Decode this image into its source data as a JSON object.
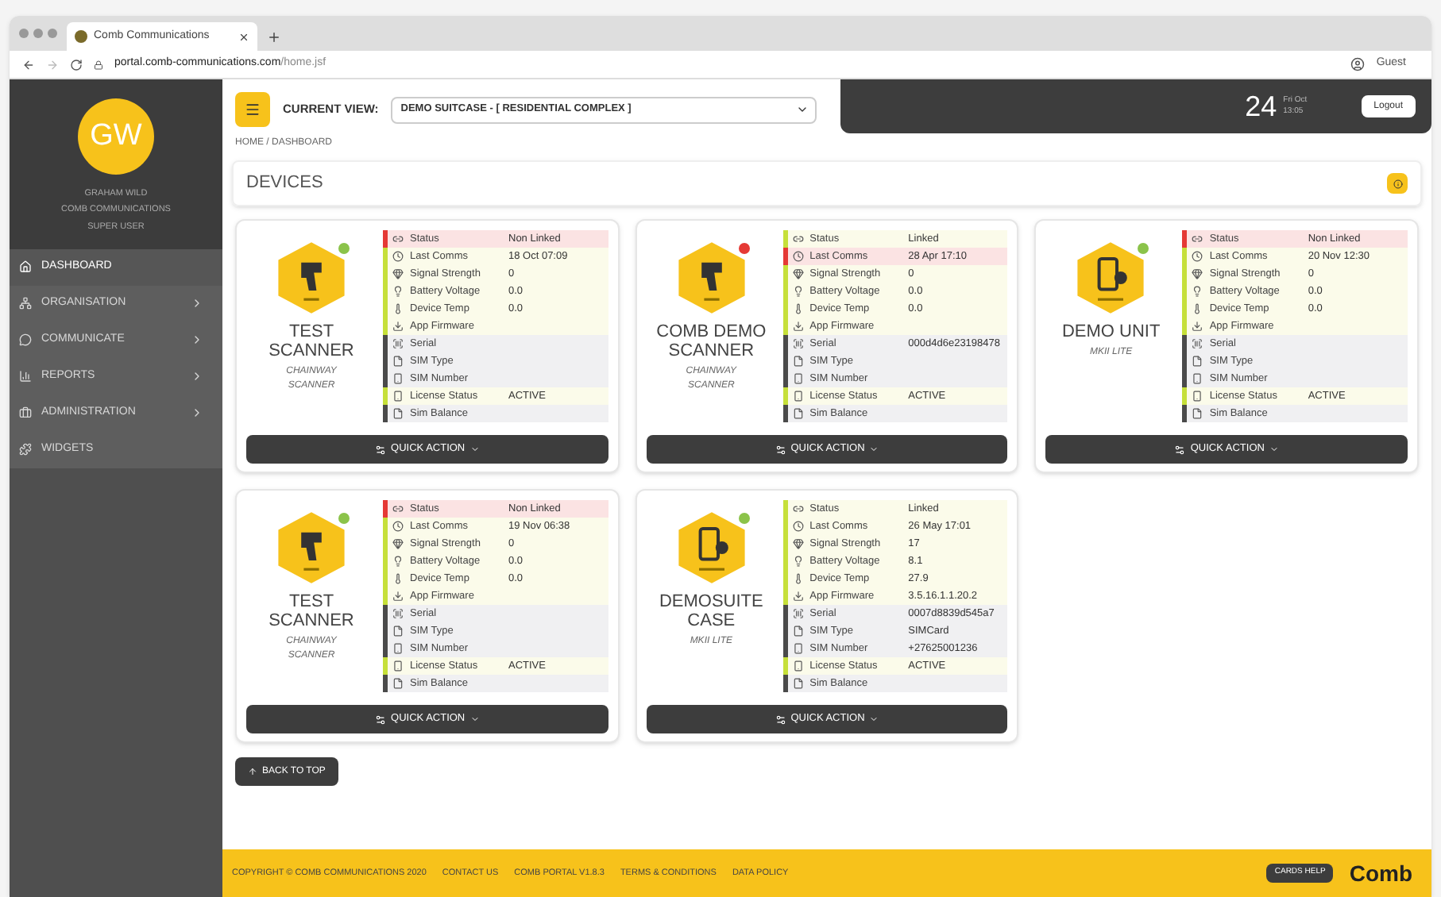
{
  "browser": {
    "tab_title": "Comb Communications",
    "url_host": "portal.comb-communications.com",
    "url_path": "/home.jsf",
    "profile": "Guest"
  },
  "sidebar": {
    "avatar": "GW",
    "user_name": "GRAHAM WILD",
    "company": "COMB COMMUNICATIONS",
    "role": "SUPER USER",
    "items": [
      {
        "label": "DASHBOARD",
        "kind": "home",
        "selected": true,
        "expandable": false
      },
      {
        "label": "ORGANISATION",
        "kind": "org",
        "selected": false,
        "expandable": true
      },
      {
        "label": "COMMUNICATE",
        "kind": "chat",
        "selected": false,
        "expandable": true
      },
      {
        "label": "REPORTS",
        "kind": "chart",
        "selected": false,
        "expandable": true
      },
      {
        "label": "ADMINISTRATION",
        "kind": "admin",
        "selected": false,
        "expandable": true
      },
      {
        "label": "WIDGETS",
        "kind": "widget",
        "selected": false,
        "expandable": false
      }
    ]
  },
  "header": {
    "current_view_label": "CURRENT VIEW:",
    "current_view": "DEMO SUITCASE - [ RESIDENTIAL COMPLEX ]",
    "day": "24",
    "month": "Fri Oct",
    "time": "13:05",
    "logout": "Logout"
  },
  "breadcrumb": "HOME / DASHBOARD",
  "devices_title": "DEVICES",
  "devices": [
    {
      "name": "TEST SCANNER",
      "model": "CHAINWAY SCANNER",
      "kind": "scanner",
      "color": "#8bc34a",
      "action": "QUICK ACTION",
      "rows": [
        {
          "label": "Status",
          "value": "Non Linked",
          "color": "#e53935"
        },
        {
          "label": "Last Comms",
          "value": "18 Oct 07:09",
          "color": "#c6e03a"
        },
        {
          "label": "Signal Strength",
          "value": "0",
          "color": "#c6e03a"
        },
        {
          "label": "Battery Voltage",
          "value": "0.0",
          "color": "#c6e03a"
        },
        {
          "label": "Device Temp",
          "value": "0.0",
          "color": "#c6e03a"
        },
        {
          "label": "App Firmware",
          "color": "#c6e03a"
        },
        {
          "label": "Serial",
          "color": "#4a4a4a"
        },
        {
          "label": "SIM Type",
          "color": "#4a4a4a"
        },
        {
          "label": "SIM Number",
          "color": "#4a4a4a"
        },
        {
          "label": "License Status",
          "value": "ACTIVE",
          "color": "#c6e03a"
        },
        {
          "label": "Sim Balance",
          "color": "#4a4a4a"
        }
      ]
    },
    {
      "name": "COMB DEMO SCANNER",
      "model": "CHAINWAY SCANNER",
      "kind": "scanner",
      "color": "#e53935",
      "action": "QUICK ACTION",
      "rows": [
        {
          "label": "Status",
          "value": "Linked",
          "color": "#c6e03a"
        },
        {
          "label": "Last Comms",
          "value": "28 Apr 17:10",
          "color": "#e53935"
        },
        {
          "label": "Signal Strength",
          "value": "0",
          "color": "#c6e03a"
        },
        {
          "label": "Battery Voltage",
          "value": "0.0",
          "color": "#c6e03a"
        },
        {
          "label": "Device Temp",
          "value": "0.0",
          "color": "#c6e03a"
        },
        {
          "label": "App Firmware",
          "color": "#c6e03a"
        },
        {
          "label": "Serial",
          "value": "000d4d6e23198478",
          "color": "#4a4a4a"
        },
        {
          "label": "SIM Type",
          "color": "#4a4a4a"
        },
        {
          "label": "SIM Number",
          "color": "#4a4a4a"
        },
        {
          "label": "License Status",
          "value": "ACTIVE",
          "color": "#c6e03a"
        },
        {
          "label": "Sim Balance",
          "color": "#4a4a4a"
        }
      ]
    },
    {
      "name": "DEMO UNIT",
      "model": "MKII LITE",
      "kind": "phone",
      "color": "#8bc34a",
      "action": "QUICK ACTION",
      "rows": [
        {
          "label": "Status",
          "value": "Non Linked",
          "color": "#e53935"
        },
        {
          "label": "Last Comms",
          "value": "20 Nov 12:30",
          "color": "#c6e03a"
        },
        {
          "label": "Signal Strength",
          "value": "0",
          "color": "#c6e03a"
        },
        {
          "label": "Battery Voltage",
          "value": "0.0",
          "color": "#c6e03a"
        },
        {
          "label": "Device Temp",
          "value": "0.0",
          "color": "#c6e03a"
        },
        {
          "label": "App Firmware",
          "color": "#c6e03a"
        },
        {
          "label": "Serial",
          "color": "#4a4a4a"
        },
        {
          "label": "SIM Type",
          "color": "#4a4a4a"
        },
        {
          "label": "SIM Number",
          "color": "#4a4a4a"
        },
        {
          "label": "License Status",
          "value": "ACTIVE",
          "color": "#c6e03a"
        },
        {
          "label": "Sim Balance",
          "color": "#4a4a4a"
        }
      ]
    },
    {
      "name": "TEST SCANNER",
      "model": "CHAINWAY SCANNER",
      "kind": "scanner",
      "color": "#8bc34a",
      "action": "QUICK ACTION",
      "rows": [
        {
          "label": "Status",
          "value": "Non Linked",
          "color": "#e53935"
        },
        {
          "label": "Last Comms",
          "value": "19 Nov 06:38",
          "color": "#c6e03a"
        },
        {
          "label": "Signal Strength",
          "value": "0",
          "color": "#c6e03a"
        },
        {
          "label": "Battery Voltage",
          "value": "0.0",
          "color": "#c6e03a"
        },
        {
          "label": "Device Temp",
          "value": "0.0",
          "color": "#c6e03a"
        },
        {
          "label": "App Firmware",
          "color": "#c6e03a"
        },
        {
          "label": "Serial",
          "color": "#4a4a4a"
        },
        {
          "label": "SIM Type",
          "color": "#4a4a4a"
        },
        {
          "label": "SIM Number",
          "color": "#4a4a4a"
        },
        {
          "label": "License Status",
          "value": "ACTIVE",
          "color": "#c6e03a"
        },
        {
          "label": "Sim Balance",
          "color": "#4a4a4a"
        }
      ]
    },
    {
      "name": "DEMOSUITE CASE",
      "model": "MKII LITE",
      "kind": "phone",
      "color": "#8bc34a",
      "action": "QUICK ACTION",
      "rows": [
        {
          "label": "Status",
          "value": "Linked",
          "color": "#c6e03a"
        },
        {
          "label": "Last Comms",
          "value": "26 May 17:01",
          "color": "#c6e03a"
        },
        {
          "label": "Signal Strength",
          "value": "17",
          "color": "#c6e03a"
        },
        {
          "label": "Battery Voltage",
          "value": "8.1",
          "color": "#c6e03a"
        },
        {
          "label": "Device Temp",
          "value": "27.9",
          "color": "#c6e03a"
        },
        {
          "label": "App Firmware",
          "value": "3.5.16.1.1.20.2",
          "color": "#c6e03a"
        },
        {
          "label": "Serial",
          "value": "0007d8839d545a7",
          "color": "#4a4a4a"
        },
        {
          "label": "SIM Type",
          "value": "SIMCard",
          "color": "#4a4a4a"
        },
        {
          "label": "SIM Number",
          "value": "+27625001236",
          "color": "#4a4a4a"
        },
        {
          "label": "License Status",
          "value": "ACTIVE",
          "color": "#c6e03a"
        },
        {
          "label": "Sim Balance",
          "color": "#4a4a4a"
        }
      ]
    }
  ],
  "back_to_top": "BACK TO TOP",
  "footer": {
    "links": [
      "COPYRIGHT © COMB COMMUNICATIONS 2020",
      "CONTACT US",
      "COMB PORTAL V1.8.3",
      "TERMS & CONDITIONS",
      "DATA POLICY"
    ],
    "help": "CARDS HELP",
    "logo": "Comb"
  }
}
